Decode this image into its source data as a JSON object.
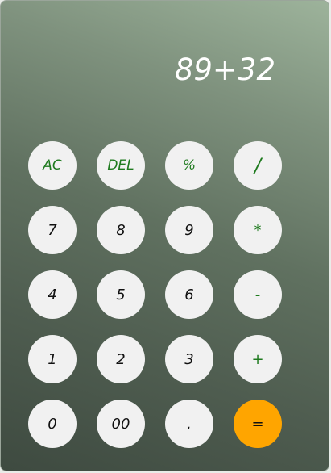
{
  "display": {
    "expression": "89+32"
  },
  "keys": {
    "ac": "AC",
    "del": "DEL",
    "percent": "%",
    "divide": "/",
    "seven": "7",
    "eight": "8",
    "nine": "9",
    "multiply": "*",
    "four": "4",
    "five": "5",
    "six": "6",
    "minus": "-",
    "one": "1",
    "two": "2",
    "three": "3",
    "plus": "+",
    "zero": "0",
    "double_zero": "00",
    "decimal": ".",
    "equals": "="
  },
  "colors": {
    "function_key_text": "#1e7a1e",
    "key_background": "#f1f1f1",
    "equals_background": "#ffa500",
    "display_text": "#ffffff"
  }
}
